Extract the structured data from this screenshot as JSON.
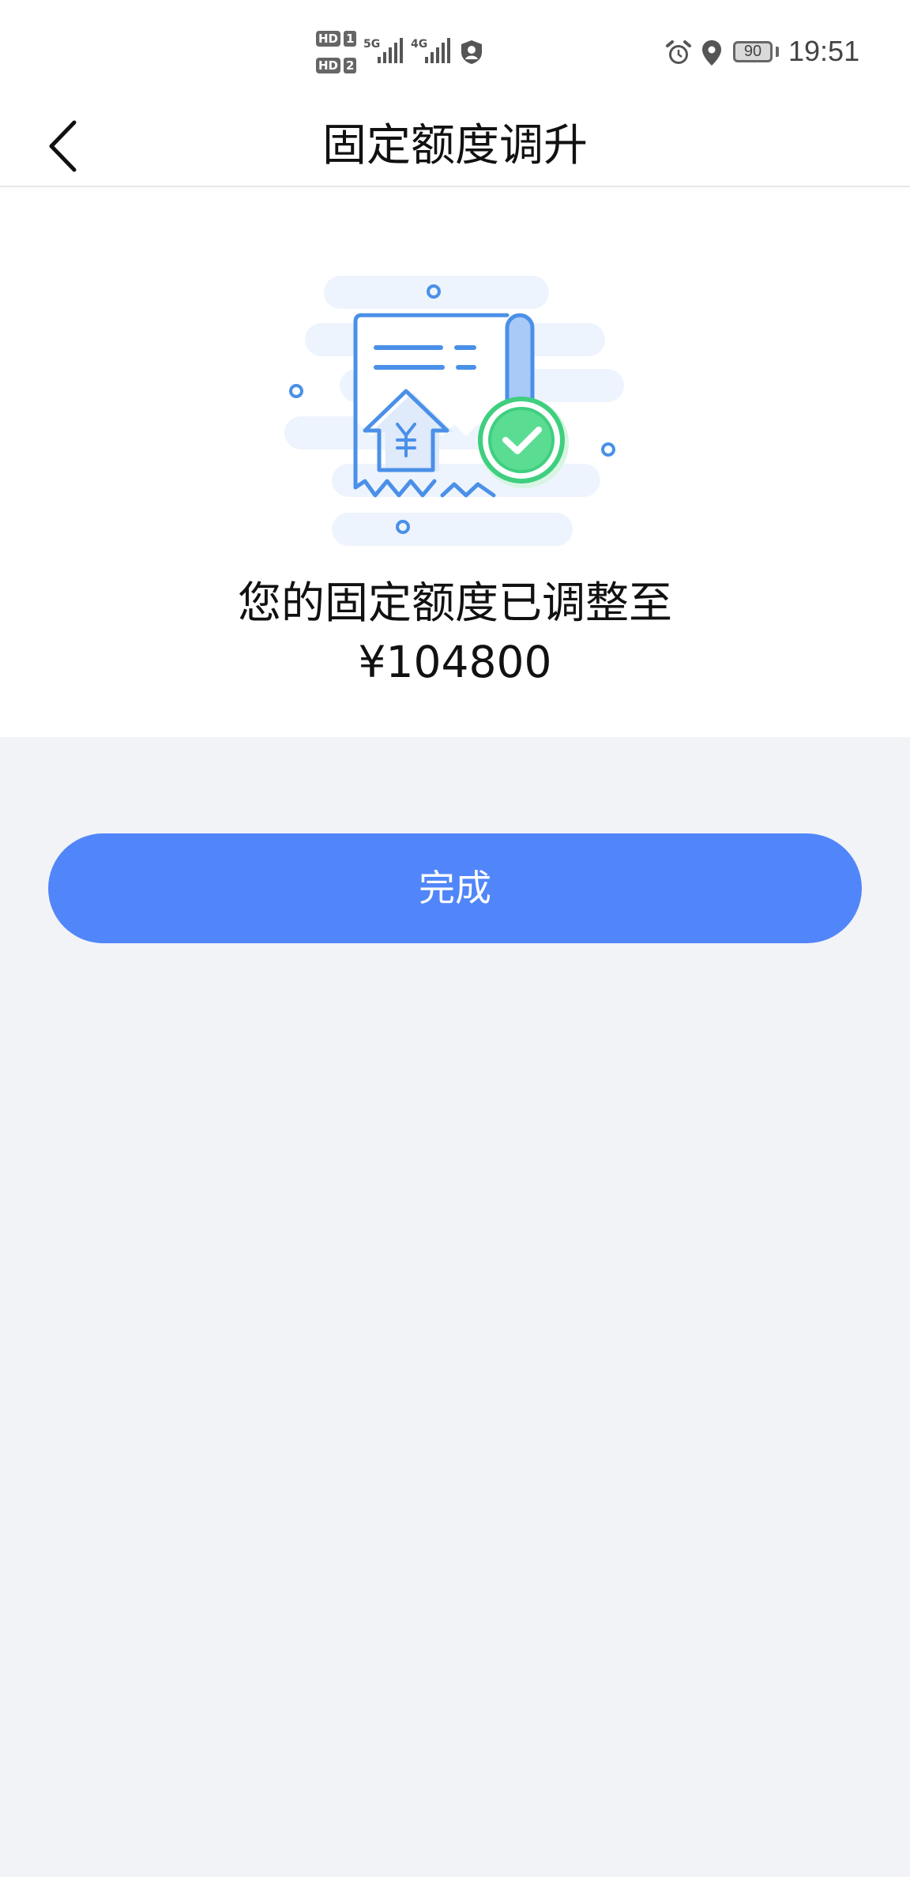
{
  "status_bar": {
    "hd1_label": "HD",
    "hd1_num": "1",
    "hd2_label": "HD",
    "hd2_num": "2",
    "net1": "5G",
    "net2": "4G",
    "battery": "90",
    "time": "19:51"
  },
  "nav": {
    "title": "固定额度调升"
  },
  "result": {
    "message": "您的固定额度已调整至",
    "amount": "¥104800"
  },
  "actions": {
    "done_label": "完成"
  },
  "colors": {
    "accent": "#5186fa",
    "success": "#3fcf7f",
    "page_bg": "#f2f3f7"
  }
}
